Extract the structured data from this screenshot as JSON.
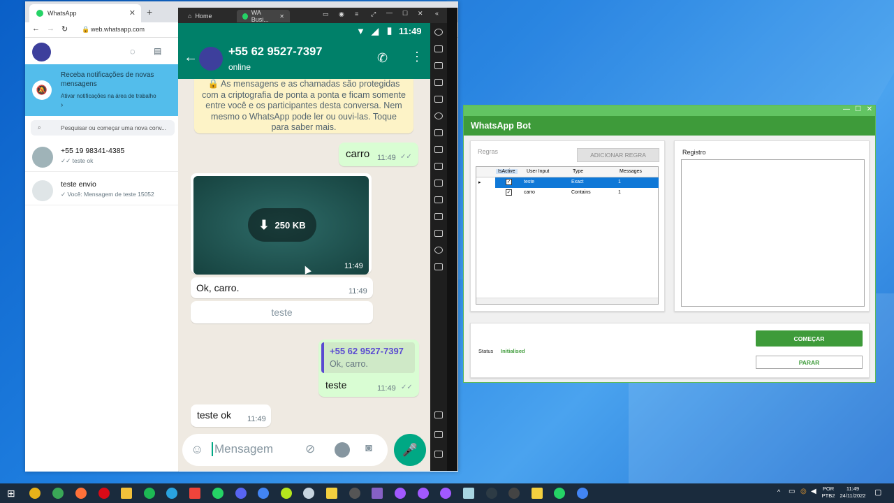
{
  "browser": {
    "tab_title": "WhatsApp",
    "url": "web.whatsapp.com",
    "notification": {
      "title": "Receba notificações de novas mensagens",
      "subtitle": "Ativar notificações na área de trabalho",
      "chevron": "›"
    },
    "search_placeholder": "Pesquisar ou começar uma nova conv...",
    "chats": [
      {
        "name": "+55 19 98341-4385",
        "preview": "✓✓ teste ok"
      },
      {
        "name": "teste envio",
        "preview": "✓ Você: Mensagem de teste 15052"
      }
    ]
  },
  "emulator": {
    "tabs": [
      {
        "label": "Home"
      },
      {
        "label": "WA Busi..."
      }
    ],
    "status_time": "11:49",
    "contact_number": "+55 62 9527-7397",
    "contact_status": "online",
    "encryption_notice": "🔒 As mensagens e as chamadas são protegidas com a criptografia de ponta a ponta e ficam somente entre você e os participantes desta conversa. Nem mesmo o WhatsApp pode ler ou ouvi-las. Toque para saber mais.",
    "messages": {
      "m1_text": "carro",
      "m1_time": "11:49",
      "media_size": "250 KB",
      "media_time": "11:49",
      "m2_text": "Ok, carro.",
      "m2_time": "11:49",
      "m3_button": "teste",
      "m4_quote_author": "+55 62 9527-7397",
      "m4_quote_text": "Ok, carro.",
      "m4_text": "teste",
      "m4_time": "11:49",
      "m5_text": "teste ok",
      "m5_time": "11:49"
    },
    "input_placeholder": "Mensagem"
  },
  "bot": {
    "title": "WhatsApp Bot",
    "rules_label": "Regras",
    "add_rule_button": "ADICIONAR REGRA",
    "log_label": "Registro",
    "grid_headers": [
      "IsActive",
      "User Input",
      "Type",
      "Messages"
    ],
    "rows": [
      {
        "user_input": "teste",
        "type": "Exact",
        "messages": "1"
      },
      {
        "user_input": "carro",
        "type": "Contains",
        "messages": "1"
      }
    ],
    "status_label": "Status",
    "status_value": "Initialised",
    "start_button": "COMEÇAR",
    "stop_button": "PARAR"
  },
  "taskbar": {
    "lang1": "POR",
    "lang2": "PTB2",
    "time": "11:49",
    "date": "24/11/2022"
  },
  "colors": {
    "wa_green": "#008069",
    "bot_green": "#3e9b3a",
    "taskbar": "#1a2b3d"
  }
}
